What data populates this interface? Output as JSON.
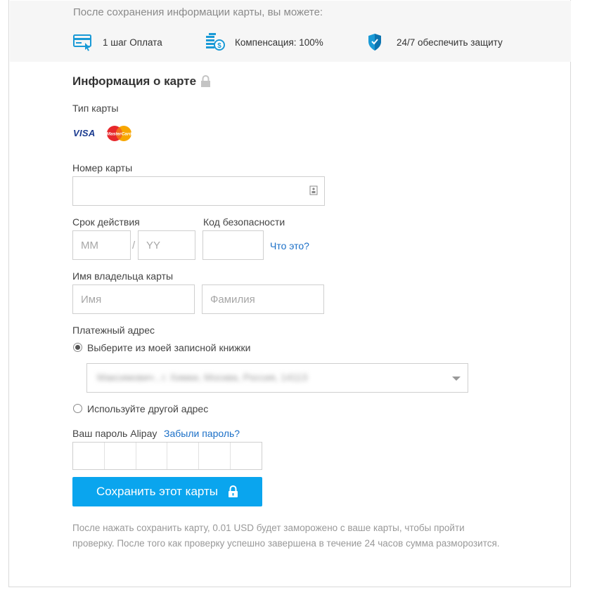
{
  "banner": {
    "intro": "После сохранения информации карты, вы можете:",
    "benefits": [
      {
        "icon": "credit-card-icon",
        "label": "1 шаг Оплата"
      },
      {
        "icon": "coins-dollar-icon",
        "label": "Компенсация: 100%"
      },
      {
        "icon": "shield-check-icon",
        "label": "24/7 обеспечить защиту"
      }
    ]
  },
  "form": {
    "title": "Информация о карте",
    "card_type_label": "Тип карты",
    "card_brands": [
      "VISA",
      "MasterCard"
    ],
    "card_number_label": "Номер карты",
    "card_number_value": "",
    "expiry_label": "Срок действия",
    "expiry_month_placeholder": "MM",
    "expiry_separator": "/",
    "expiry_year_placeholder": "YY",
    "cvv_label": "Код безопасности",
    "cvv_help_link": "Что это?",
    "holder_label": "Имя владельца карты",
    "first_name_placeholder": "Имя",
    "last_name_placeholder": "Фамилия",
    "billing_label": "Платежный адрес",
    "billing_option_addressbook": "Выберите из моей записной книжки",
    "billing_selected_address": "Максимович , г. Химки, Москва, Россия, 14113",
    "billing_option_other": "Используйте другой адрес",
    "password_label": "Ваш пароль Alipay",
    "forgot_password_link": "Забыли пароль?",
    "save_button": "Сохранить этот карты",
    "note": "После нажать сохранить карту, 0.01 USD будет заморожено с ваше карты, чтобы пройти проверку. После того как проверку успешно завершена в течение 24 часов сумма разморозится."
  },
  "colors": {
    "primary_button": "#0aa5ee",
    "link": "#1a6fc7",
    "icon_blue": "#1a9ad6"
  }
}
